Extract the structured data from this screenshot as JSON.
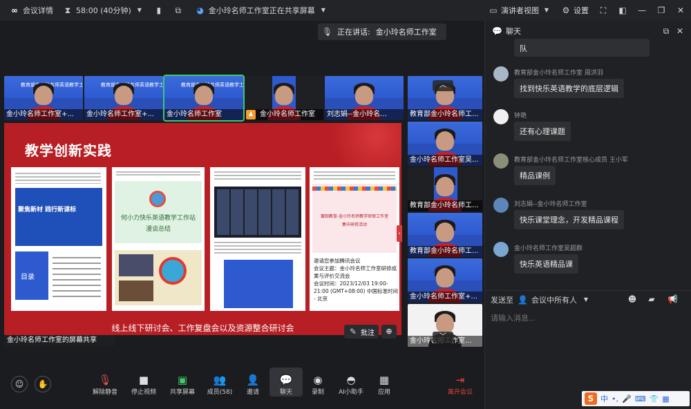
{
  "topbar": {
    "meeting_details": "会议详情",
    "timer": "58:00 (40分钟)",
    "sharing": "金小玲名师工作室正在共享屏幕",
    "view": "演讲者视图",
    "settings": "设置"
  },
  "speaking": {
    "label": "正在讲话:",
    "name": "金小玲名师工作室"
  },
  "tiles": [
    {
      "label": "金小玲名师工作室+..."
    },
    {
      "label": "金小玲名师工作室+..."
    },
    {
      "label": "金小玲名师工作室"
    },
    {
      "label": "金小玲名师工作室"
    },
    {
      "label": "刘志娟--金小玲名..."
    },
    {
      "label": "教育部金小玲名师工..."
    },
    {
      "label": "金小玲名师工作室吴..."
    },
    {
      "label": "教育部金小玲名师工..."
    },
    {
      "label": "教育部金小玲名师工..."
    },
    {
      "label": "金小玲名师工作室+..."
    },
    {
      "label": "金小玲名师工作室..."
    }
  ],
  "tile_banner": "教育部金小玲名师英语教学工作室",
  "slide": {
    "title": "教学创新实践",
    "caption": "线上线下研讨会、工作复盘会以及资源整合研讨会",
    "card1_head": "聚焦新材 践行新课标",
    "card1_sub": "目录",
    "card2_title": "何小力快乐英语教学工作站",
    "card2_sub": "漫谈总结",
    "card4_head": "莆田教育-金小玲名师教学研修工作室",
    "card4_sub": "集中研修活动",
    "card4_text": "邀请您参加腾讯会议\n会议主题：金小玲名师工作室研修成果与评价交流会\n会议时间：2023/12/03 19:00-21:00 (GMT+08:00) 中国标准时间 - 北京"
  },
  "annotate": "批注",
  "share_label": "金小玲名师工作室的屏幕共享",
  "toolbar": {
    "unmute": "解除静音",
    "stop_video": "停止视频",
    "share": "共享屏幕",
    "members": "成员(58)",
    "invite": "邀请",
    "chat": "聊天",
    "record": "录制",
    "ai": "AI小助手",
    "apps": "应用",
    "leave": "离开会议"
  },
  "chat": {
    "title": "聊天",
    "partial_bubble": "队",
    "messages": [
      {
        "sender": "教育部金小玲名师工作室 周洪羽",
        "text": "找到快乐英语教学的底层逻辑"
      },
      {
        "sender": "钟艳",
        "text": "还有心理课题"
      },
      {
        "sender": "教育部金小玲名师工作室核心成员 王小军",
        "text": "精品课例"
      },
      {
        "sender": "刘志娟--金小玲名师工作室",
        "text": "快乐课堂理念，开发精品课程"
      },
      {
        "sender": "金小玲名师工作室吴超群",
        "text": "快乐英语精品课"
      }
    ],
    "send_to_label": "发送至",
    "send_to_value": "会议中所有人",
    "placeholder": "请输入消息..."
  },
  "ime": {
    "mode": "中"
  },
  "colors": {
    "slide_red": "#b71f24",
    "tile_blue": "#2e5ad0",
    "leave_red": "#e0443a",
    "ime_blue": "#2b69d6"
  }
}
